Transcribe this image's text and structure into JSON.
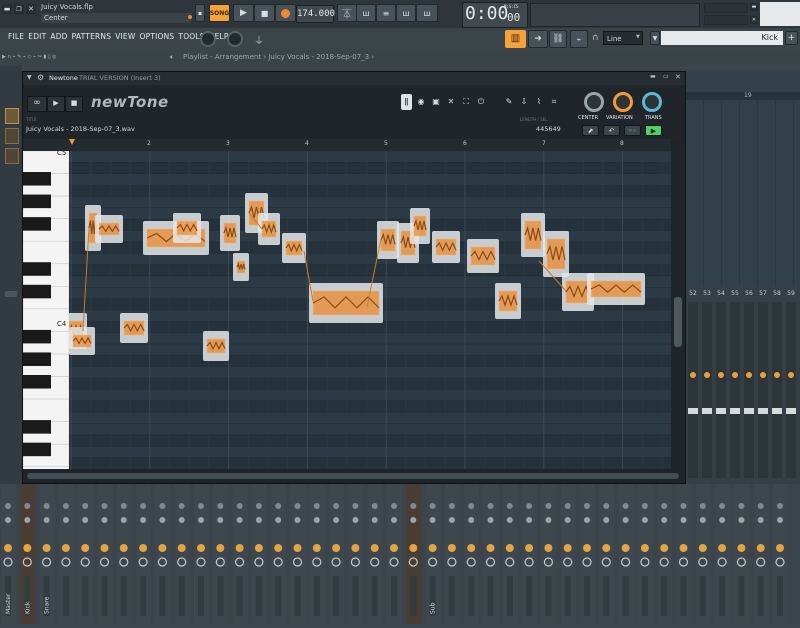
{
  "topbar": {
    "project_name": "Juicy Vocals.flp",
    "hint": "Center",
    "pattern_label": "SONG",
    "tempo": "174.000",
    "time_main": "0:00",
    "time_sub": "00",
    "time_unit": "M:S:CS"
  },
  "menu": {
    "items": [
      "FILE",
      "EDIT",
      "ADD",
      "PATTERNS",
      "VIEW",
      "OPTIONS",
      "TOOLS",
      "HELP"
    ],
    "snap_value": "Line",
    "channel_name": "Kick"
  },
  "playlist": {
    "title": "Playlist - Arrangement",
    "clip": "Juicy Vocals - 2018-Sep-07_3",
    "bar_number": "19"
  },
  "newtone": {
    "window_title": "Newtone",
    "trial_text": "TRIAL VERSION (Insert 3)",
    "logo": "newTone",
    "title_caption": "TITLE",
    "file_name": "Juicy Vocals - 2018-Sep-07_3.wav",
    "length_caption": "LENGTH / SEL",
    "length_value": "445649",
    "knobs": [
      "CENTER",
      "VARIATION",
      "TRANS"
    ],
    "ruler": [
      "2",
      "3",
      "4",
      "5",
      "6",
      "7",
      "8"
    ],
    "note_labels": {
      "c5": "C5",
      "c4": "C4"
    },
    "colors": {
      "note": "#ec8a2e",
      "bg": "#283640",
      "accent": "#f39b37"
    }
  },
  "mixer": {
    "track_labels": [
      "Master",
      "Kick",
      "Snare",
      "",
      "",
      "",
      "",
      "",
      "",
      "",
      "",
      "",
      "",
      "",
      "",
      "",
      "",
      "",
      "",
      "",
      "",
      "",
      "Sub"
    ],
    "insert_numbers": [
      "52",
      "53",
      "54",
      "55",
      "56",
      "57",
      "58",
      "59"
    ]
  }
}
